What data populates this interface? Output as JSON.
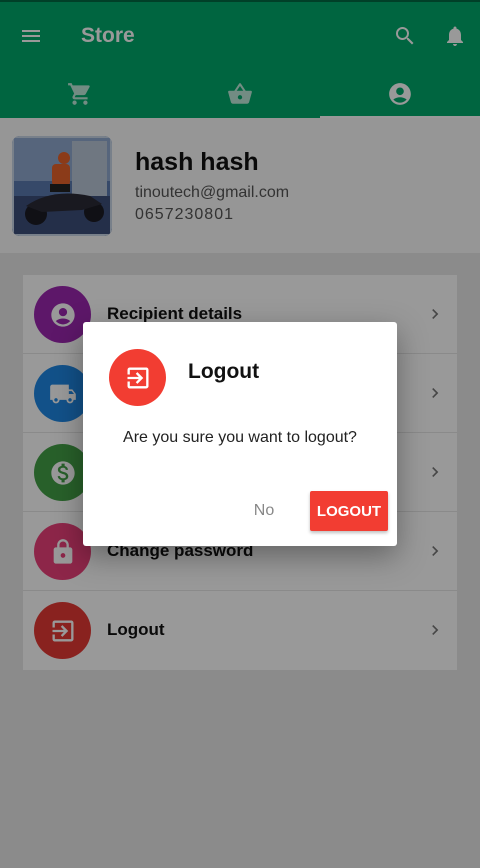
{
  "app": {
    "title": "Store",
    "menu_icon": "menu-icon",
    "search_icon": "search-icon",
    "notifications_icon": "bell-icon"
  },
  "tabs": [
    {
      "icon": "cart-icon"
    },
    {
      "icon": "basket-icon"
    },
    {
      "icon": "account-circle-icon",
      "selected": true
    }
  ],
  "profile": {
    "name": "hash hash",
    "email": "tinoutech@gmail.com",
    "phone": "0657230801"
  },
  "menu": {
    "items": [
      {
        "label": "Recipient details",
        "icon": "account-icon",
        "color": "#9c27b0"
      },
      {
        "label": "",
        "icon": "truck-icon",
        "color": "#1e88e5"
      },
      {
        "label": "",
        "icon": "dollar-icon",
        "color": "#43a047"
      },
      {
        "label": "Change password",
        "icon": "lock-icon",
        "color": "#ec407a"
      },
      {
        "label": "Logout",
        "icon": "logout-icon",
        "color": "#e53935"
      }
    ]
  },
  "dialog": {
    "title": "Logout",
    "message": "Are you sure you want to logout?",
    "cancel_label": "No",
    "confirm_label": "LOGOUT",
    "icon": "logout-icon"
  },
  "colors": {
    "primary": "#00a86b",
    "accent": "#f23d32"
  }
}
